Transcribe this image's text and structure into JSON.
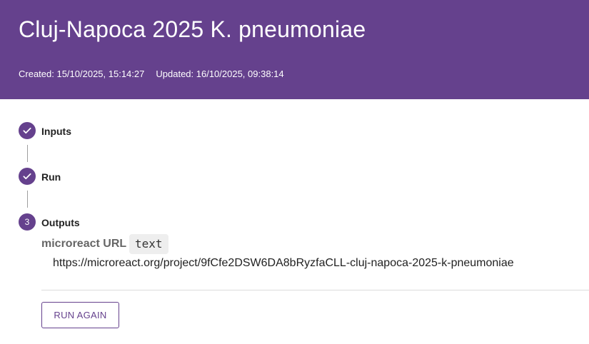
{
  "header": {
    "title": "Cluj-Napoca 2025 K. pneumoniae",
    "created": "Created: 15/10/2025, 15:14:27",
    "updated": "Updated: 16/10/2025, 09:38:14",
    "background_color": "#65418d"
  },
  "steps": [
    {
      "label": "Inputs",
      "status": "complete",
      "icon": "check-icon"
    },
    {
      "label": "Run",
      "status": "complete",
      "icon": "check-icon"
    },
    {
      "label": "Outputs",
      "status": "active",
      "number": "3"
    }
  ],
  "outputs": {
    "name": "microreact URL",
    "type": "text",
    "value": "https://microreact.org/project/9fCfe2DSW6DA8bRyzfaCLL-cluj-napoca-2025-k-pneumoniae"
  },
  "actions": {
    "run_again_label": "RUN AGAIN"
  },
  "colors": {
    "accent": "#65418d"
  }
}
